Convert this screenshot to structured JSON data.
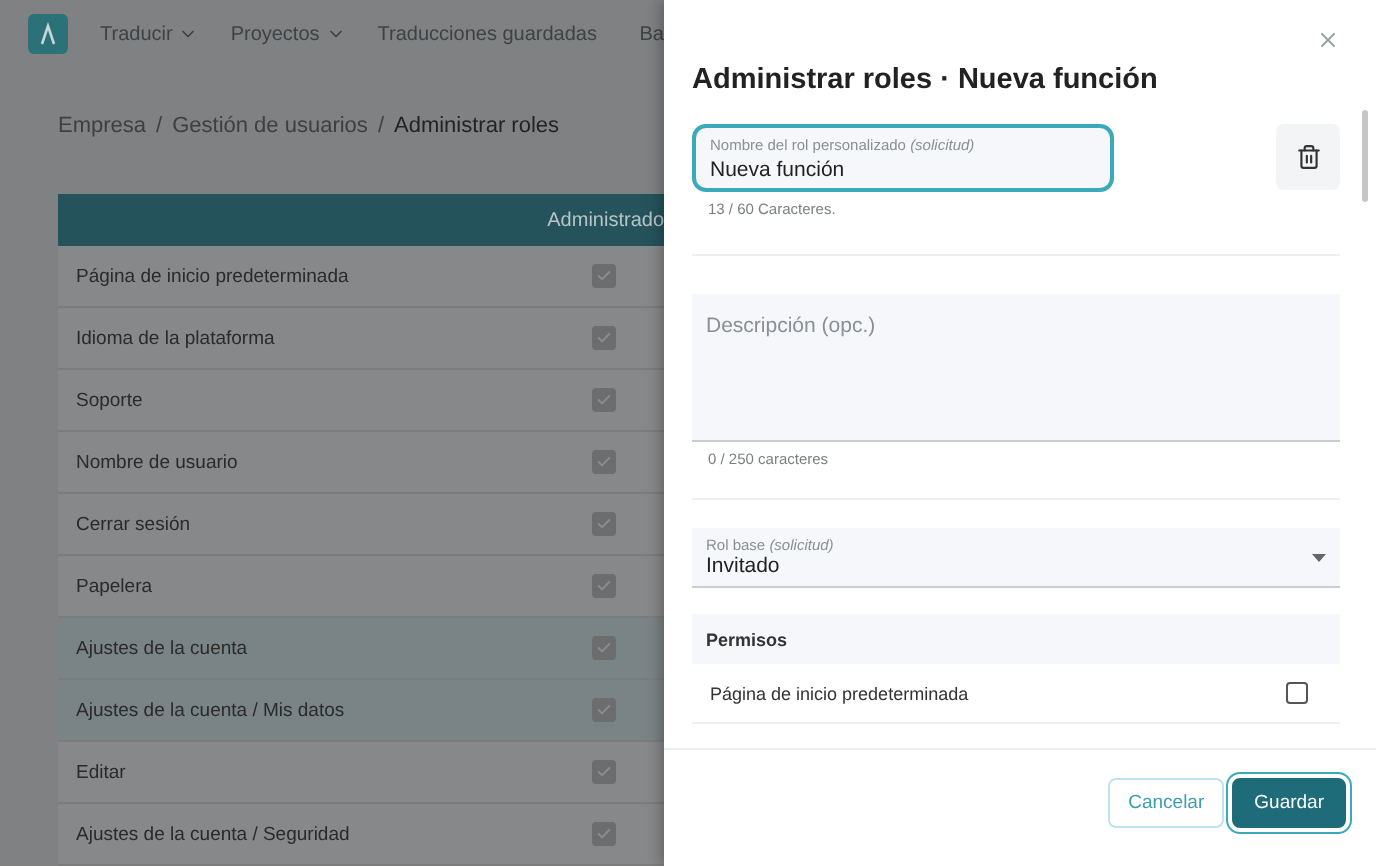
{
  "nav": {
    "items": [
      {
        "label": "Traducir",
        "dropdown": true
      },
      {
        "label": "Proyectos",
        "dropdown": true
      },
      {
        "label": "Traducciones guardadas",
        "dropdown": false
      },
      {
        "label": "Ba",
        "dropdown": false
      }
    ]
  },
  "breadcrumb": {
    "separator": "/",
    "items": [
      {
        "label": "Empresa",
        "current": false
      },
      {
        "label": "Gestión de usuarios",
        "current": false
      },
      {
        "label": "Administrar roles",
        "current": true
      }
    ]
  },
  "table": {
    "columns": [
      "Administrado"
    ],
    "rows": [
      {
        "label": "Página de inicio predeterminada",
        "checked": true,
        "selected": false
      },
      {
        "label": "Idioma de la plataforma",
        "checked": true,
        "selected": false
      },
      {
        "label": "Soporte",
        "checked": true,
        "selected": false
      },
      {
        "label": "Nombre de usuario",
        "checked": true,
        "selected": false
      },
      {
        "label": "Cerrar sesión",
        "checked": true,
        "selected": false
      },
      {
        "label": "Papelera",
        "checked": true,
        "selected": false
      },
      {
        "label": "Ajustes de la cuenta",
        "checked": true,
        "selected": true
      },
      {
        "label": "Ajustes de la cuenta / Mis datos",
        "checked": true,
        "selected": true
      },
      {
        "label": "Editar",
        "checked": true,
        "selected": false
      },
      {
        "label": "Ajustes de la cuenta / Seguridad",
        "checked": true,
        "selected": false
      }
    ]
  },
  "drawer": {
    "title": "Administrar roles · Nueva función",
    "name_field": {
      "label": "Nombre del rol personalizado *(solicitud)*",
      "value": "Nueva función",
      "focused": true,
      "counter": "13 / 60 Caracteres."
    },
    "description_field": {
      "placeholder": "Descripción (opc.)",
      "counter": "0 / 250 caracteres"
    },
    "base_role": {
      "label": "Rol base *(solicitud)*",
      "value": "Invitado"
    },
    "permissions": {
      "title": "Permisos",
      "items": [
        {
          "label": "Página de inicio predeterminada",
          "checked": false
        }
      ]
    },
    "buttons": [
      {
        "label": "Cancelar",
        "kind": "secondary"
      },
      {
        "label": "Guardar",
        "kind": "primary"
      }
    ]
  }
}
